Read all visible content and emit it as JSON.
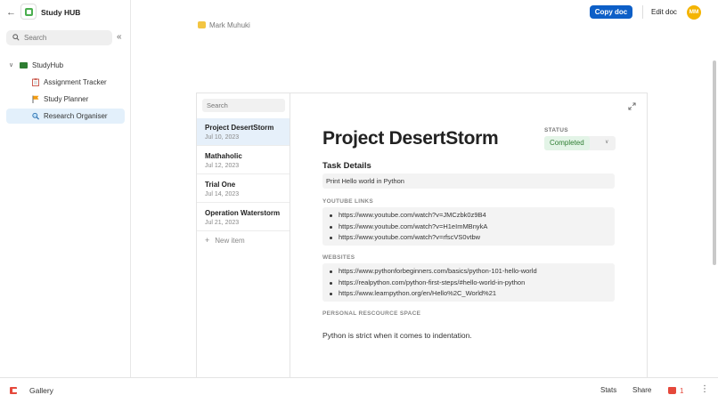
{
  "sidebar": {
    "app_title": "Study HUB",
    "search_placeholder": "Search",
    "root": {
      "label": "StudyHub"
    },
    "items": [
      {
        "label": "Assignment Tracker",
        "icon": "clipboard-icon",
        "active": false
      },
      {
        "label": "Study Planner",
        "icon": "flag-icon",
        "active": false
      },
      {
        "label": "Research Organiser",
        "icon": "magnifier-icon",
        "active": true
      }
    ]
  },
  "topbar": {
    "author": "Mark Muhuki",
    "copy_label": "Copy doc",
    "edit_label": "Edit doc",
    "avatar_initials": "MM"
  },
  "list": {
    "search_placeholder": "Search",
    "items": [
      {
        "title": "Project DesertStorm",
        "date": "Jul 10, 2023"
      },
      {
        "title": "Mathaholic",
        "date": "Jul 12, 2023"
      },
      {
        "title": "Trial One",
        "date": "Jul 14, 2023"
      },
      {
        "title": "Operation Waterstorm",
        "date": "Jul 21, 2023"
      }
    ],
    "new_item_label": "New item"
  },
  "doc": {
    "title": "Project DesertStorm",
    "status_label": "STATUS",
    "status_value": "Completed",
    "task_details_heading": "Task Details",
    "task_details_value": "Print Hello world in Python",
    "youtube_label": "YOUTUBE LINKS",
    "youtube_links": [
      "https://www.youtube.com/watch?v=JMCzbk0z9B4",
      "https://www.youtube.com/watch?v=H1eImMBnykA",
      "https://www.youtube.com/watch?v=rfscVS0vtbw"
    ],
    "websites_label": "WEBSITES",
    "websites": [
      "https://www.pythonforbeginners.com/basics/python-101-hello-world",
      "https://realpython.com/python-first-steps/#hello-world-in-python",
      "https://www.learnpython.org/en/Hello%2C_World%21"
    ],
    "personal_label": "PERSONAL RESCOURCE SPACE",
    "personal_text": "Python is strict when it comes to indentation."
  },
  "bottombar": {
    "gallery_label": "Gallery",
    "stats_label": "Stats",
    "share_label": "Share",
    "like_count": "1"
  },
  "colors": {
    "accent": "#0d5fc7",
    "selected_bg": "#e3f0fb",
    "status_green": "#2e7d32",
    "brand_red": "#e5483b"
  }
}
